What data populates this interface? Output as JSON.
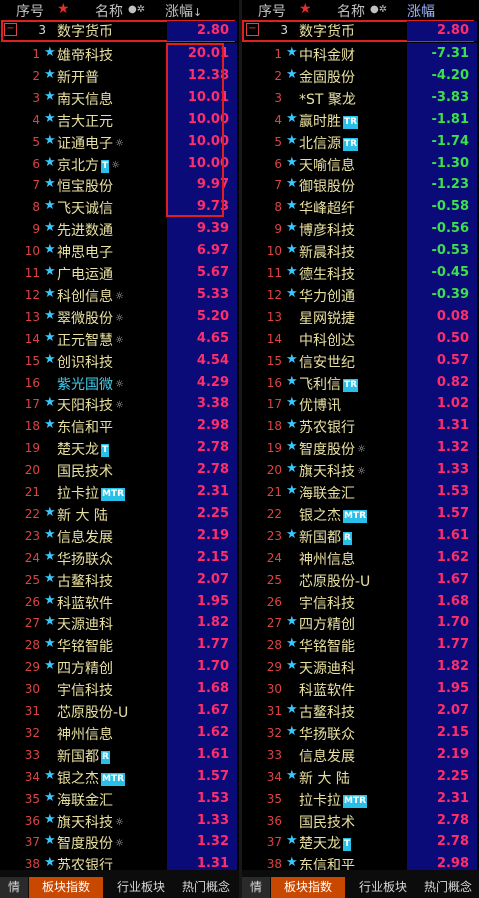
{
  "header": {
    "index": "序号",
    "star": "★",
    "name": "名称",
    "change": "涨幅",
    "sort_arrow": "↓"
  },
  "fund": {
    "index": "3",
    "name": "数字货币",
    "change": "2.80"
  },
  "left_rows": [
    {
      "n": "1",
      "star": true,
      "name": "雄帝科技",
      "tag": "",
      "gear": false,
      "v": "20.01",
      "d": "up"
    },
    {
      "n": "2",
      "star": true,
      "name": "新开普",
      "tag": "",
      "gear": false,
      "v": "12.38",
      "d": "up"
    },
    {
      "n": "3",
      "star": true,
      "name": "南天信息",
      "tag": "",
      "gear": false,
      "v": "10.01",
      "d": "up"
    },
    {
      "n": "4",
      "star": true,
      "name": "吉大正元",
      "tag": "",
      "gear": false,
      "v": "10.00",
      "d": "up"
    },
    {
      "n": "5",
      "star": true,
      "name": "证通电子",
      "tag": "",
      "gear": true,
      "v": "10.00",
      "d": "up"
    },
    {
      "n": "6",
      "star": true,
      "name": "京北方",
      "tag": "T",
      "gear": true,
      "v": "10.00",
      "d": "up"
    },
    {
      "n": "7",
      "star": true,
      "name": "恒宝股份",
      "tag": "",
      "gear": false,
      "v": "9.97",
      "d": "up"
    },
    {
      "n": "8",
      "star": true,
      "name": "飞天诚信",
      "tag": "",
      "gear": false,
      "v": "9.73",
      "d": "up"
    },
    {
      "n": "9",
      "star": true,
      "name": "先进数通",
      "tag": "",
      "gear": false,
      "v": "9.39",
      "d": "up"
    },
    {
      "n": "10",
      "star": true,
      "name": "神思电子",
      "tag": "",
      "gear": false,
      "v": "6.97",
      "d": "up"
    },
    {
      "n": "11",
      "star": true,
      "name": "广电运通",
      "tag": "",
      "gear": false,
      "v": "5.67",
      "d": "up"
    },
    {
      "n": "12",
      "star": true,
      "name": "科创信息",
      "tag": "",
      "gear": true,
      "v": "5.33",
      "d": "up"
    },
    {
      "n": "13",
      "star": true,
      "name": "翠微股份",
      "tag": "",
      "gear": true,
      "v": "5.20",
      "d": "up"
    },
    {
      "n": "14",
      "star": true,
      "name": "正元智慧",
      "tag": "",
      "gear": true,
      "v": "4.65",
      "d": "up"
    },
    {
      "n": "15",
      "star": true,
      "name": "创识科技",
      "tag": "",
      "gear": false,
      "v": "4.54",
      "d": "up"
    },
    {
      "n": "16",
      "star": false,
      "name": "紫光国微",
      "tag": "",
      "gear": true,
      "v": "4.29",
      "d": "up",
      "cyan": true
    },
    {
      "n": "17",
      "star": true,
      "name": "天阳科技",
      "tag": "",
      "gear": true,
      "v": "3.38",
      "d": "up"
    },
    {
      "n": "18",
      "star": true,
      "name": "东信和平",
      "tag": "",
      "gear": false,
      "v": "2.98",
      "d": "up"
    },
    {
      "n": "19",
      "star": false,
      "name": "楚天龙",
      "tag": "T",
      "gear": false,
      "v": "2.78",
      "d": "up"
    },
    {
      "n": "20",
      "star": false,
      "name": "国民技术",
      "tag": "",
      "gear": false,
      "v": "2.78",
      "d": "up"
    },
    {
      "n": "21",
      "star": false,
      "name": "拉卡拉",
      "tag": "MTR",
      "gear": false,
      "v": "2.31",
      "d": "up"
    },
    {
      "n": "22",
      "star": true,
      "name": "新 大 陆",
      "tag": "",
      "gear": false,
      "v": "2.25",
      "d": "up"
    },
    {
      "n": "23",
      "star": true,
      "name": "信息发展",
      "tag": "",
      "gear": false,
      "v": "2.19",
      "d": "up"
    },
    {
      "n": "24",
      "star": true,
      "name": "华扬联众",
      "tag": "",
      "gear": false,
      "v": "2.15",
      "d": "up"
    },
    {
      "n": "25",
      "star": true,
      "name": "古鳌科技",
      "tag": "",
      "gear": false,
      "v": "2.07",
      "d": "up"
    },
    {
      "n": "26",
      "star": true,
      "name": "科蓝软件",
      "tag": "",
      "gear": false,
      "v": "1.95",
      "d": "up"
    },
    {
      "n": "27",
      "star": true,
      "name": "天源迪科",
      "tag": "",
      "gear": false,
      "v": "1.82",
      "d": "up"
    },
    {
      "n": "28",
      "star": true,
      "name": "华铭智能",
      "tag": "",
      "gear": false,
      "v": "1.77",
      "d": "up"
    },
    {
      "n": "29",
      "star": true,
      "name": "四方精创",
      "tag": "",
      "gear": false,
      "v": "1.70",
      "d": "up"
    },
    {
      "n": "30",
      "star": false,
      "name": "宇信科技",
      "tag": "",
      "gear": false,
      "v": "1.68",
      "d": "up"
    },
    {
      "n": "31",
      "star": false,
      "name": "芯原股份-U",
      "tag": "",
      "gear": false,
      "v": "1.67",
      "d": "up"
    },
    {
      "n": "32",
      "star": false,
      "name": "神州信息",
      "tag": "",
      "gear": false,
      "v": "1.62",
      "d": "up"
    },
    {
      "n": "33",
      "star": false,
      "name": "新国都",
      "tag": "R",
      "gear": false,
      "v": "1.61",
      "d": "up"
    },
    {
      "n": "34",
      "star": true,
      "name": "银之杰",
      "tag": "MTR",
      "gear": false,
      "v": "1.57",
      "d": "up"
    },
    {
      "n": "35",
      "star": true,
      "name": "海联金汇",
      "tag": "",
      "gear": false,
      "v": "1.53",
      "d": "up"
    },
    {
      "n": "36",
      "star": true,
      "name": "旗天科技",
      "tag": "",
      "gear": true,
      "v": "1.33",
      "d": "up"
    },
    {
      "n": "37",
      "star": true,
      "name": "智度股份",
      "tag": "",
      "gear": true,
      "v": "1.32",
      "d": "up"
    },
    {
      "n": "38",
      "star": true,
      "name": "苏农银行",
      "tag": "",
      "gear": false,
      "v": "1.31",
      "d": "up"
    }
  ],
  "right_rows": [
    {
      "n": "1",
      "star": true,
      "name": "中科金财",
      "tag": "",
      "gear": false,
      "v": "-7.31",
      "d": "down"
    },
    {
      "n": "2",
      "star": true,
      "name": "金固股份",
      "tag": "",
      "gear": false,
      "v": "-4.20",
      "d": "down"
    },
    {
      "n": "3",
      "star": false,
      "name": "*ST 聚龙",
      "tag": "",
      "gear": false,
      "v": "-3.83",
      "d": "down"
    },
    {
      "n": "4",
      "star": true,
      "name": "赢时胜",
      "tag": "TR",
      "gear": false,
      "v": "-1.81",
      "d": "down"
    },
    {
      "n": "5",
      "star": true,
      "name": "北信源",
      "tag": "TR",
      "gear": false,
      "v": "-1.74",
      "d": "down"
    },
    {
      "n": "6",
      "star": true,
      "name": "天喻信息",
      "tag": "",
      "gear": false,
      "v": "-1.30",
      "d": "down"
    },
    {
      "n": "7",
      "star": true,
      "name": "御银股份",
      "tag": "",
      "gear": false,
      "v": "-1.23",
      "d": "down"
    },
    {
      "n": "8",
      "star": true,
      "name": "华峰超纤",
      "tag": "",
      "gear": false,
      "v": "-0.58",
      "d": "down"
    },
    {
      "n": "9",
      "star": true,
      "name": "博彦科技",
      "tag": "",
      "gear": false,
      "v": "-0.56",
      "d": "down"
    },
    {
      "n": "10",
      "star": true,
      "name": "新晨科技",
      "tag": "",
      "gear": false,
      "v": "-0.53",
      "d": "down"
    },
    {
      "n": "11",
      "star": true,
      "name": "德生科技",
      "tag": "",
      "gear": false,
      "v": "-0.45",
      "d": "down"
    },
    {
      "n": "12",
      "star": true,
      "name": "华力创通",
      "tag": "",
      "gear": false,
      "v": "-0.39",
      "d": "down"
    },
    {
      "n": "13",
      "star": false,
      "name": "星网锐捷",
      "tag": "",
      "gear": false,
      "v": "0.08",
      "d": "up"
    },
    {
      "n": "14",
      "star": false,
      "name": "中科创达",
      "tag": "",
      "gear": false,
      "v": "0.50",
      "d": "up"
    },
    {
      "n": "15",
      "star": true,
      "name": "信安世纪",
      "tag": "",
      "gear": false,
      "v": "0.57",
      "d": "up"
    },
    {
      "n": "16",
      "star": true,
      "name": "飞利信",
      "tag": "TR",
      "gear": false,
      "v": "0.82",
      "d": "up"
    },
    {
      "n": "17",
      "star": true,
      "name": "优博讯",
      "tag": "",
      "gear": false,
      "v": "1.02",
      "d": "up"
    },
    {
      "n": "18",
      "star": true,
      "name": "苏农银行",
      "tag": "",
      "gear": false,
      "v": "1.31",
      "d": "up"
    },
    {
      "n": "19",
      "star": true,
      "name": "智度股份",
      "tag": "",
      "gear": true,
      "v": "1.32",
      "d": "up"
    },
    {
      "n": "20",
      "star": true,
      "name": "旗天科技",
      "tag": "",
      "gear": true,
      "v": "1.33",
      "d": "up"
    },
    {
      "n": "21",
      "star": true,
      "name": "海联金汇",
      "tag": "",
      "gear": false,
      "v": "1.53",
      "d": "up"
    },
    {
      "n": "22",
      "star": false,
      "name": "银之杰",
      "tag": "MTR",
      "gear": false,
      "v": "1.57",
      "d": "up"
    },
    {
      "n": "23",
      "star": true,
      "name": "新国都",
      "tag": "R",
      "gear": false,
      "v": "1.61",
      "d": "up"
    },
    {
      "n": "24",
      "star": false,
      "name": "神州信息",
      "tag": "",
      "gear": false,
      "v": "1.62",
      "d": "up"
    },
    {
      "n": "25",
      "star": false,
      "name": "芯原股份-U",
      "tag": "",
      "gear": false,
      "v": "1.67",
      "d": "up"
    },
    {
      "n": "26",
      "star": false,
      "name": "宇信科技",
      "tag": "",
      "gear": false,
      "v": "1.68",
      "d": "up"
    },
    {
      "n": "27",
      "star": true,
      "name": "四方精创",
      "tag": "",
      "gear": false,
      "v": "1.70",
      "d": "up"
    },
    {
      "n": "28",
      "star": true,
      "name": "华铭智能",
      "tag": "",
      "gear": false,
      "v": "1.77",
      "d": "up"
    },
    {
      "n": "29",
      "star": true,
      "name": "天源迪科",
      "tag": "",
      "gear": false,
      "v": "1.82",
      "d": "up"
    },
    {
      "n": "30",
      "star": false,
      "name": "科蓝软件",
      "tag": "",
      "gear": false,
      "v": "1.95",
      "d": "up"
    },
    {
      "n": "31",
      "star": true,
      "name": "古鳌科技",
      "tag": "",
      "gear": false,
      "v": "2.07",
      "d": "up"
    },
    {
      "n": "32",
      "star": true,
      "name": "华扬联众",
      "tag": "",
      "gear": false,
      "v": "2.15",
      "d": "up"
    },
    {
      "n": "33",
      "star": false,
      "name": "信息发展",
      "tag": "",
      "gear": false,
      "v": "2.19",
      "d": "up"
    },
    {
      "n": "34",
      "star": true,
      "name": "新 大 陆",
      "tag": "",
      "gear": false,
      "v": "2.25",
      "d": "up"
    },
    {
      "n": "35",
      "star": false,
      "name": "拉卡拉",
      "tag": "MTR",
      "gear": false,
      "v": "2.31",
      "d": "up"
    },
    {
      "n": "36",
      "star": false,
      "name": "国民技术",
      "tag": "",
      "gear": false,
      "v": "2.78",
      "d": "up"
    },
    {
      "n": "37",
      "star": true,
      "name": "楚天龙",
      "tag": "T",
      "gear": false,
      "v": "2.78",
      "d": "up"
    },
    {
      "n": "38",
      "star": true,
      "name": "东信和平",
      "tag": "",
      "gear": false,
      "v": "2.98",
      "d": "up"
    }
  ],
  "bottom_tabs": {
    "left": [
      "情",
      "板块指数",
      "行业板块",
      "热门概念"
    ],
    "right": [
      "情",
      "板块指数",
      "行业板块",
      "热门概念"
    ]
  },
  "colors": {
    "up": "#ff2e6a",
    "down": "#3ce04a",
    "value_bg": "#0a0a78",
    "highlight_border": "#e02020"
  }
}
